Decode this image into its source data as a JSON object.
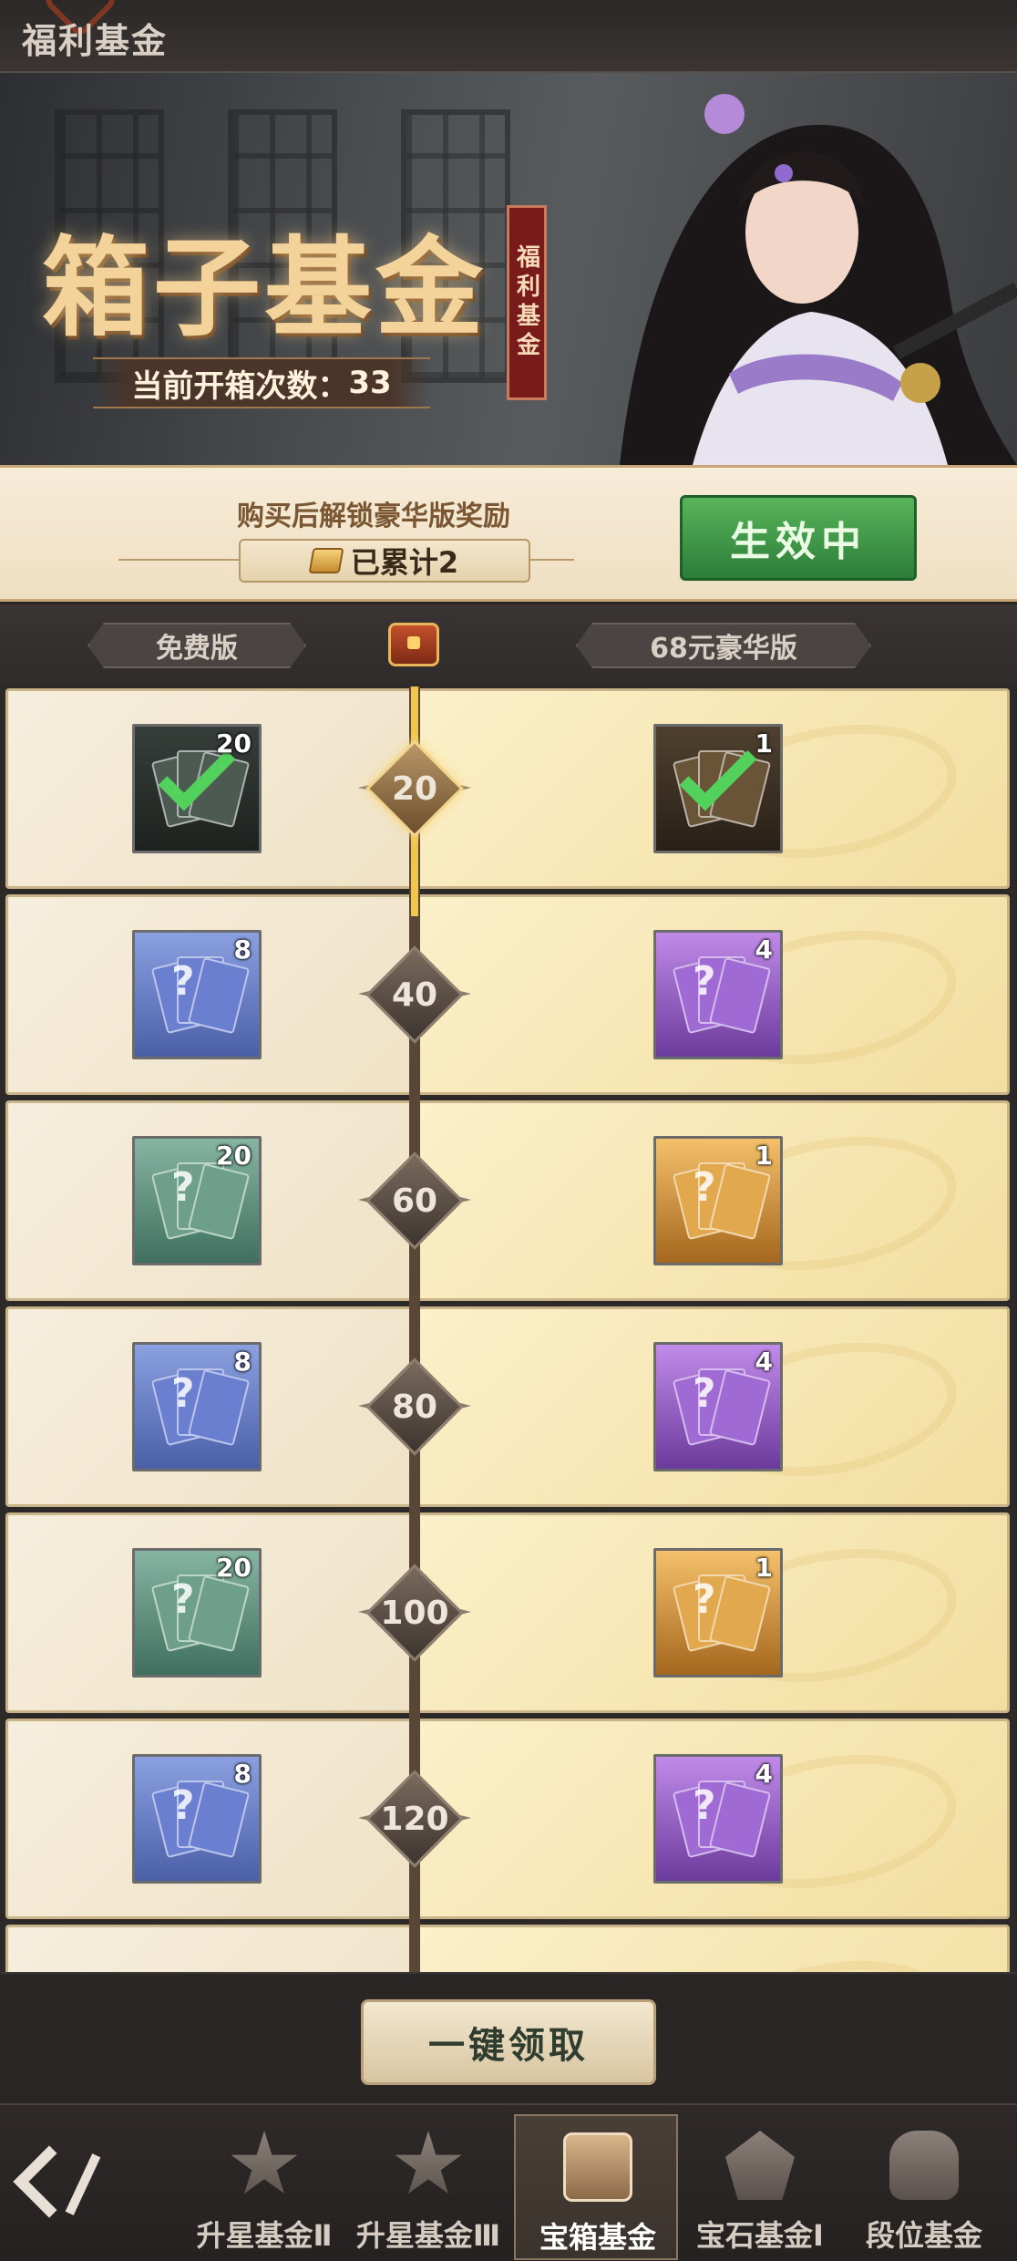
{
  "header": {
    "title": "福利基金"
  },
  "banner": {
    "title": "箱子基金",
    "seal_text": "福利基金",
    "open_count_label": "当前开箱次数：",
    "open_count": "33"
  },
  "unlock": {
    "description": "购买后解锁豪华版奖励",
    "accumulated": "已累计2",
    "status_button": "生效中"
  },
  "versions": {
    "free_label": "免费版",
    "deluxe_label": "68元豪华版"
  },
  "rewards": [
    {
      "milestone": "20",
      "free_qty": "20",
      "free_tier": "dark",
      "deluxe_qty": "1",
      "deluxe_tier": "brown",
      "claimed": true
    },
    {
      "milestone": "40",
      "free_qty": "8",
      "free_tier": "blue",
      "deluxe_qty": "4",
      "deluxe_tier": "purple",
      "claimed": false
    },
    {
      "milestone": "60",
      "free_qty": "20",
      "free_tier": "green",
      "deluxe_qty": "1",
      "deluxe_tier": "gold",
      "claimed": false
    },
    {
      "milestone": "80",
      "free_qty": "8",
      "free_tier": "blue",
      "deluxe_qty": "4",
      "deluxe_tier": "purple",
      "claimed": false
    },
    {
      "milestone": "100",
      "free_qty": "20",
      "free_tier": "green",
      "deluxe_qty": "1",
      "deluxe_tier": "gold",
      "claimed": false
    },
    {
      "milestone": "120",
      "free_qty": "8",
      "free_tier": "blue",
      "deluxe_qty": "4",
      "deluxe_tier": "purple",
      "claimed": false
    }
  ],
  "claim_all_label": "一键领取",
  "tabs": [
    {
      "label": "升星基金Ⅱ",
      "icon": "star-icon"
    },
    {
      "label": "升星基金Ⅲ",
      "icon": "star-icon"
    },
    {
      "label": "宝箱基金",
      "icon": "chest-icon",
      "active": true
    },
    {
      "label": "宝石基金Ⅰ",
      "icon": "gem-icon"
    },
    {
      "label": "段位基金",
      "icon": "helmet-icon"
    }
  ],
  "colors": {
    "status_green": "#3f9a47",
    "progress_gold": "#f0c64c",
    "free_bg": "#f3e8d1",
    "deluxe_bg": "#f8e8b4"
  }
}
